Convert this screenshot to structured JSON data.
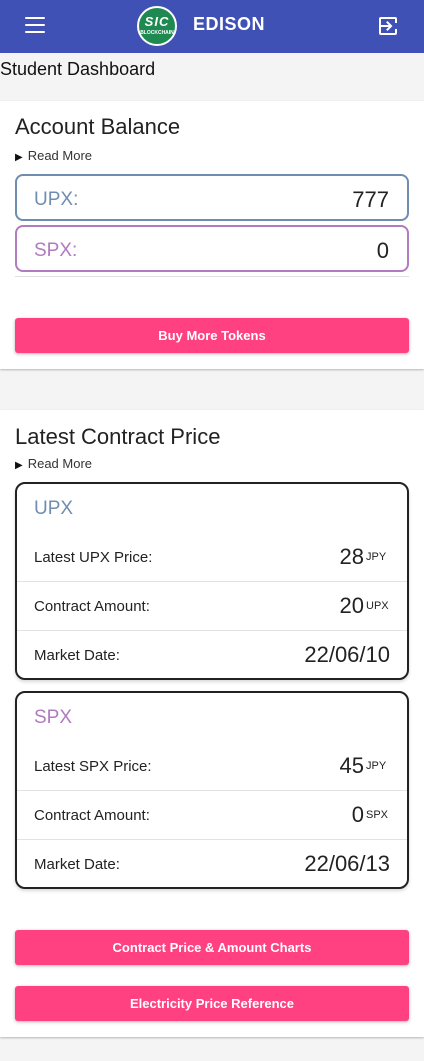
{
  "header": {
    "title": "EDISON",
    "logo_text_top": "SIC",
    "logo_text_bottom": "BLOCKCHAIN"
  },
  "icons": {
    "menu": "menu-icon",
    "logout": "logout-icon"
  },
  "page": {
    "title": "Student Dashboard"
  },
  "balance": {
    "title": "Account Balance",
    "read_more": "Read More",
    "upx": {
      "label": "UPX:",
      "value": "777"
    },
    "spx": {
      "label": "SPX:",
      "value": "0"
    },
    "buy_button": "Buy More Tokens"
  },
  "contract": {
    "title": "Latest Contract Price",
    "read_more": "Read More",
    "upx": {
      "title": "UPX",
      "price_label": "Latest UPX Price:",
      "price_value": "28",
      "price_unit": "JPY",
      "amount_label": "Contract Amount:",
      "amount_value": "20",
      "amount_unit": "UPX",
      "date_label": "Market Date:",
      "date_value": "22/06/10"
    },
    "spx": {
      "title": "SPX",
      "price_label": "Latest SPX Price:",
      "price_value": "45",
      "price_unit": "JPY",
      "amount_label": "Contract Amount:",
      "amount_value": "0",
      "amount_unit": "SPX",
      "date_label": "Market Date:",
      "date_value": "22/06/13"
    },
    "charts_button": "Contract Price & Amount Charts",
    "electricity_button": "Electricity Price Reference"
  },
  "colors": {
    "appbar": "#3f51b5",
    "accent": "#ff4081",
    "upx": "#6f8db0",
    "spx": "#b07bbf"
  }
}
